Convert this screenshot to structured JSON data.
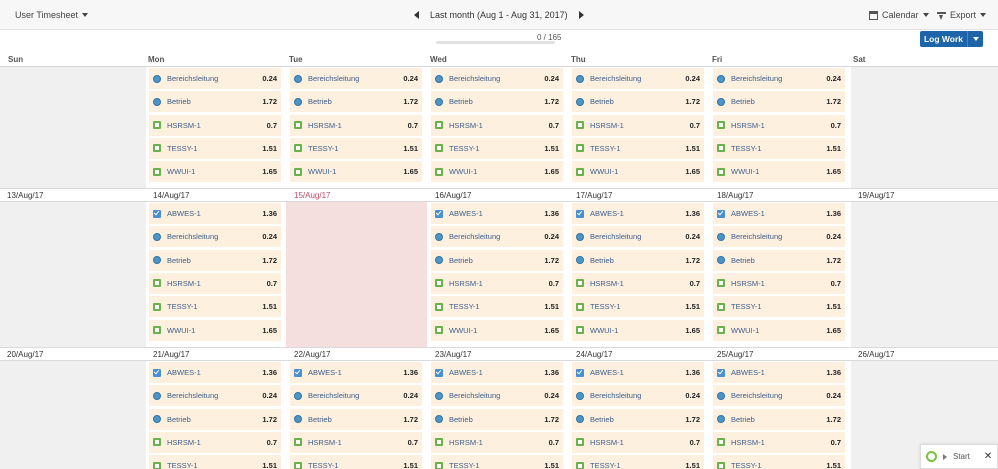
{
  "header": {
    "view_selector": "User Timesheet",
    "period": "Last month (Aug 1 - Aug 31, 2017)",
    "calendar_label": "Calendar",
    "export_label": "Export",
    "progress_text": "0 / 165",
    "progress_fraction": 0.0,
    "log_work_label": "Log Work"
  },
  "days": [
    "Sun",
    "Mon",
    "Tue",
    "Wed",
    "Thu",
    "Fri",
    "Sat"
  ],
  "weeks": [
    {
      "dates": [
        "",
        "",
        "",
        "",
        "",
        "",
        ""
      ],
      "cells": [
        [],
        [
          {
            "icon": "globe",
            "label": "Bereichsleitung",
            "hours": "0.24"
          },
          {
            "icon": "globe",
            "label": "Betrieb",
            "hours": "1.72"
          },
          {
            "icon": "sq",
            "label": "HSRSM-1",
            "hours": "0.7"
          },
          {
            "icon": "sq",
            "label": "TESSY-1",
            "hours": "1.51"
          },
          {
            "icon": "sq",
            "label": "WWUI-1",
            "hours": "1.65"
          }
        ],
        [
          {
            "icon": "globe",
            "label": "Bereichsleitung",
            "hours": "0.24"
          },
          {
            "icon": "globe",
            "label": "Betrieb",
            "hours": "1.72"
          },
          {
            "icon": "sq",
            "label": "HSRSM-1",
            "hours": "0.7"
          },
          {
            "icon": "sq",
            "label": "TESSY-1",
            "hours": "1.51"
          },
          {
            "icon": "sq",
            "label": "WWUI-1",
            "hours": "1.65"
          }
        ],
        [
          {
            "icon": "globe",
            "label": "Bereichsleitung",
            "hours": "0.24"
          },
          {
            "icon": "globe",
            "label": "Betrieb",
            "hours": "1.72"
          },
          {
            "icon": "sq",
            "label": "HSRSM-1",
            "hours": "0.7"
          },
          {
            "icon": "sq",
            "label": "TESSY-1",
            "hours": "1.51"
          },
          {
            "icon": "sq",
            "label": "WWUI-1",
            "hours": "1.65"
          }
        ],
        [
          {
            "icon": "globe",
            "label": "Bereichsleitung",
            "hours": "0.24"
          },
          {
            "icon": "globe",
            "label": "Betrieb",
            "hours": "1.72"
          },
          {
            "icon": "sq",
            "label": "HSRSM-1",
            "hours": "0.7"
          },
          {
            "icon": "sq",
            "label": "TESSY-1",
            "hours": "1.51"
          },
          {
            "icon": "sq",
            "label": "WWUI-1",
            "hours": "1.65"
          }
        ],
        [
          {
            "icon": "globe",
            "label": "Bereichsleitung",
            "hours": "0.24"
          },
          {
            "icon": "globe",
            "label": "Betrieb",
            "hours": "1.72"
          },
          {
            "icon": "sq",
            "label": "HSRSM-1",
            "hours": "0.7"
          },
          {
            "icon": "sq",
            "label": "TESSY-1",
            "hours": "1.51"
          },
          {
            "icon": "sq",
            "label": "WWUI-1",
            "hours": "1.65"
          }
        ],
        []
      ]
    },
    {
      "dates": [
        "13/Aug/17",
        "14/Aug/17",
        "15/Aug/17",
        "16/Aug/17",
        "17/Aug/17",
        "18/Aug/17",
        "19/Aug/17"
      ],
      "holiday": 2,
      "cells": [
        [],
        [
          {
            "icon": "check",
            "label": "ABWES-1",
            "hours": "1.36"
          },
          {
            "icon": "globe",
            "label": "Bereichsleitung",
            "hours": "0.24"
          },
          {
            "icon": "globe",
            "label": "Betrieb",
            "hours": "1.72"
          },
          {
            "icon": "sq",
            "label": "HSRSM-1",
            "hours": "0.7"
          },
          {
            "icon": "sq",
            "label": "TESSY-1",
            "hours": "1.51"
          },
          {
            "icon": "sq",
            "label": "WWUI-1",
            "hours": "1.65"
          }
        ],
        [],
        [
          {
            "icon": "check",
            "label": "ABWES-1",
            "hours": "1.36"
          },
          {
            "icon": "globe",
            "label": "Bereichsleitung",
            "hours": "0.24"
          },
          {
            "icon": "globe",
            "label": "Betrieb",
            "hours": "1.72"
          },
          {
            "icon": "sq",
            "label": "HSRSM-1",
            "hours": "0.7"
          },
          {
            "icon": "sq",
            "label": "TESSY-1",
            "hours": "1.51"
          },
          {
            "icon": "sq",
            "label": "WWUI-1",
            "hours": "1.65"
          }
        ],
        [
          {
            "icon": "check",
            "label": "ABWES-1",
            "hours": "1.36"
          },
          {
            "icon": "globe",
            "label": "Bereichsleitung",
            "hours": "0.24"
          },
          {
            "icon": "globe",
            "label": "Betrieb",
            "hours": "1.72"
          },
          {
            "icon": "sq",
            "label": "HSRSM-1",
            "hours": "0.7"
          },
          {
            "icon": "sq",
            "label": "TESSY-1",
            "hours": "1.51"
          },
          {
            "icon": "sq",
            "label": "WWUI-1",
            "hours": "1.65"
          }
        ],
        [
          {
            "icon": "check",
            "label": "ABWES-1",
            "hours": "1.36"
          },
          {
            "icon": "globe",
            "label": "Bereichsleitung",
            "hours": "0.24"
          },
          {
            "icon": "globe",
            "label": "Betrieb",
            "hours": "1.72"
          },
          {
            "icon": "sq",
            "label": "HSRSM-1",
            "hours": "0.7"
          },
          {
            "icon": "sq",
            "label": "TESSY-1",
            "hours": "1.51"
          },
          {
            "icon": "sq",
            "label": "WWUI-1",
            "hours": "1.65"
          }
        ],
        []
      ]
    },
    {
      "dates": [
        "20/Aug/17",
        "21/Aug/17",
        "22/Aug/17",
        "23/Aug/17",
        "24/Aug/17",
        "25/Aug/17",
        "26/Aug/17"
      ],
      "cells": [
        [],
        [
          {
            "icon": "check",
            "label": "ABWES-1",
            "hours": "1.36"
          },
          {
            "icon": "globe",
            "label": "Bereichsleitung",
            "hours": "0.24"
          },
          {
            "icon": "globe",
            "label": "Betrieb",
            "hours": "1.72"
          },
          {
            "icon": "sq",
            "label": "HSRSM-1",
            "hours": "0.7"
          },
          {
            "icon": "sq",
            "label": "TESSY-1",
            "hours": "1.51"
          }
        ],
        [
          {
            "icon": "check",
            "label": "ABWES-1",
            "hours": "1.36"
          },
          {
            "icon": "globe",
            "label": "Bereichsleitung",
            "hours": "0.24"
          },
          {
            "icon": "globe",
            "label": "Betrieb",
            "hours": "1.72"
          },
          {
            "icon": "sq",
            "label": "HSRSM-1",
            "hours": "0.7"
          },
          {
            "icon": "sq",
            "label": "TESSY-1",
            "hours": "1.51"
          }
        ],
        [
          {
            "icon": "check",
            "label": "ABWES-1",
            "hours": "1.36"
          },
          {
            "icon": "globe",
            "label": "Bereichsleitung",
            "hours": "0.24"
          },
          {
            "icon": "globe",
            "label": "Betrieb",
            "hours": "1.72"
          },
          {
            "icon": "sq",
            "label": "HSRSM-1",
            "hours": "0.7"
          },
          {
            "icon": "sq",
            "label": "TESSY-1",
            "hours": "1.51"
          }
        ],
        [
          {
            "icon": "check",
            "label": "ABWES-1",
            "hours": "1.36"
          },
          {
            "icon": "globe",
            "label": "Bereichsleitung",
            "hours": "0.24"
          },
          {
            "icon": "globe",
            "label": "Betrieb",
            "hours": "1.72"
          },
          {
            "icon": "sq",
            "label": "HSRSM-1",
            "hours": "0.7"
          },
          {
            "icon": "sq",
            "label": "TESSY-1",
            "hours": "1.51"
          }
        ],
        [
          {
            "icon": "check",
            "label": "ABWES-1",
            "hours": "1.36"
          },
          {
            "icon": "globe",
            "label": "Bereichsleitung",
            "hours": "0.24"
          },
          {
            "icon": "globe",
            "label": "Betrieb",
            "hours": "1.72"
          },
          {
            "icon": "sq",
            "label": "HSRSM-1",
            "hours": "0.7"
          },
          {
            "icon": "sq",
            "label": "TESSY-1",
            "hours": "1.51"
          }
        ],
        []
      ]
    }
  ],
  "widget": {
    "start_label": "Start",
    "close_glyph": "✕"
  }
}
